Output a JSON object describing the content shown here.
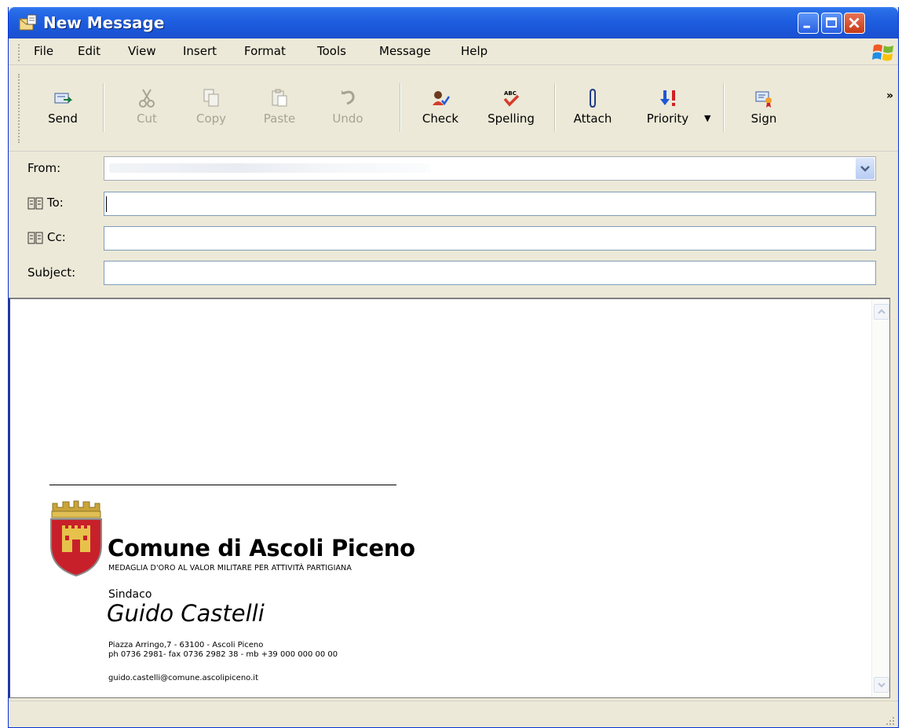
{
  "window": {
    "title": "New Message"
  },
  "menu": [
    "File",
    "Edit",
    "View",
    "Insert",
    "Format",
    "Tools",
    "Message",
    "Help"
  ],
  "toolbar": {
    "send": "Send",
    "cut": "Cut",
    "copy": "Copy",
    "paste": "Paste",
    "undo": "Undo",
    "check": "Check",
    "spelling": "Spelling",
    "attach": "Attach",
    "priority": "Priority",
    "sign": "Sign",
    "more": "»"
  },
  "header": {
    "from_label": "From:",
    "to_label": "To:",
    "cc_label": "Cc:",
    "subject_label": "Subject:",
    "to_value": "",
    "cc_value": "",
    "subject_value": ""
  },
  "signature": {
    "organization": "Comune di Ascoli Piceno",
    "motto": "MEDAGLIA D'ORO AL VALOR MILITARE PER ATTIVITÀ PARTIGIANA",
    "role": "Sindaco",
    "name": "Guido Castelli",
    "address": "Piazza Arringo,7 - 63100 - Ascoli Piceno",
    "phones": "ph 0736 2981- fax 0736 2982 38 - mb +39 000 000 00 00",
    "email": "guido.castelli@comune.ascolipiceno.it"
  },
  "icons": {
    "app": "new-message-icon",
    "minimize": "minimize-icon",
    "maximize": "maximize-icon",
    "close": "close-icon",
    "windows_logo": "windows-flag-icon",
    "address_book": "address-book-icon",
    "combo_arrow": "chevron-down-icon",
    "crest": "city-crest-icon"
  },
  "colors": {
    "titlebar": "#1e5ee0",
    "chrome": "#ece9d8",
    "close_button": "#c73a17",
    "priority_arrow": "#1f57d6",
    "priority_bang": "#d02020"
  }
}
